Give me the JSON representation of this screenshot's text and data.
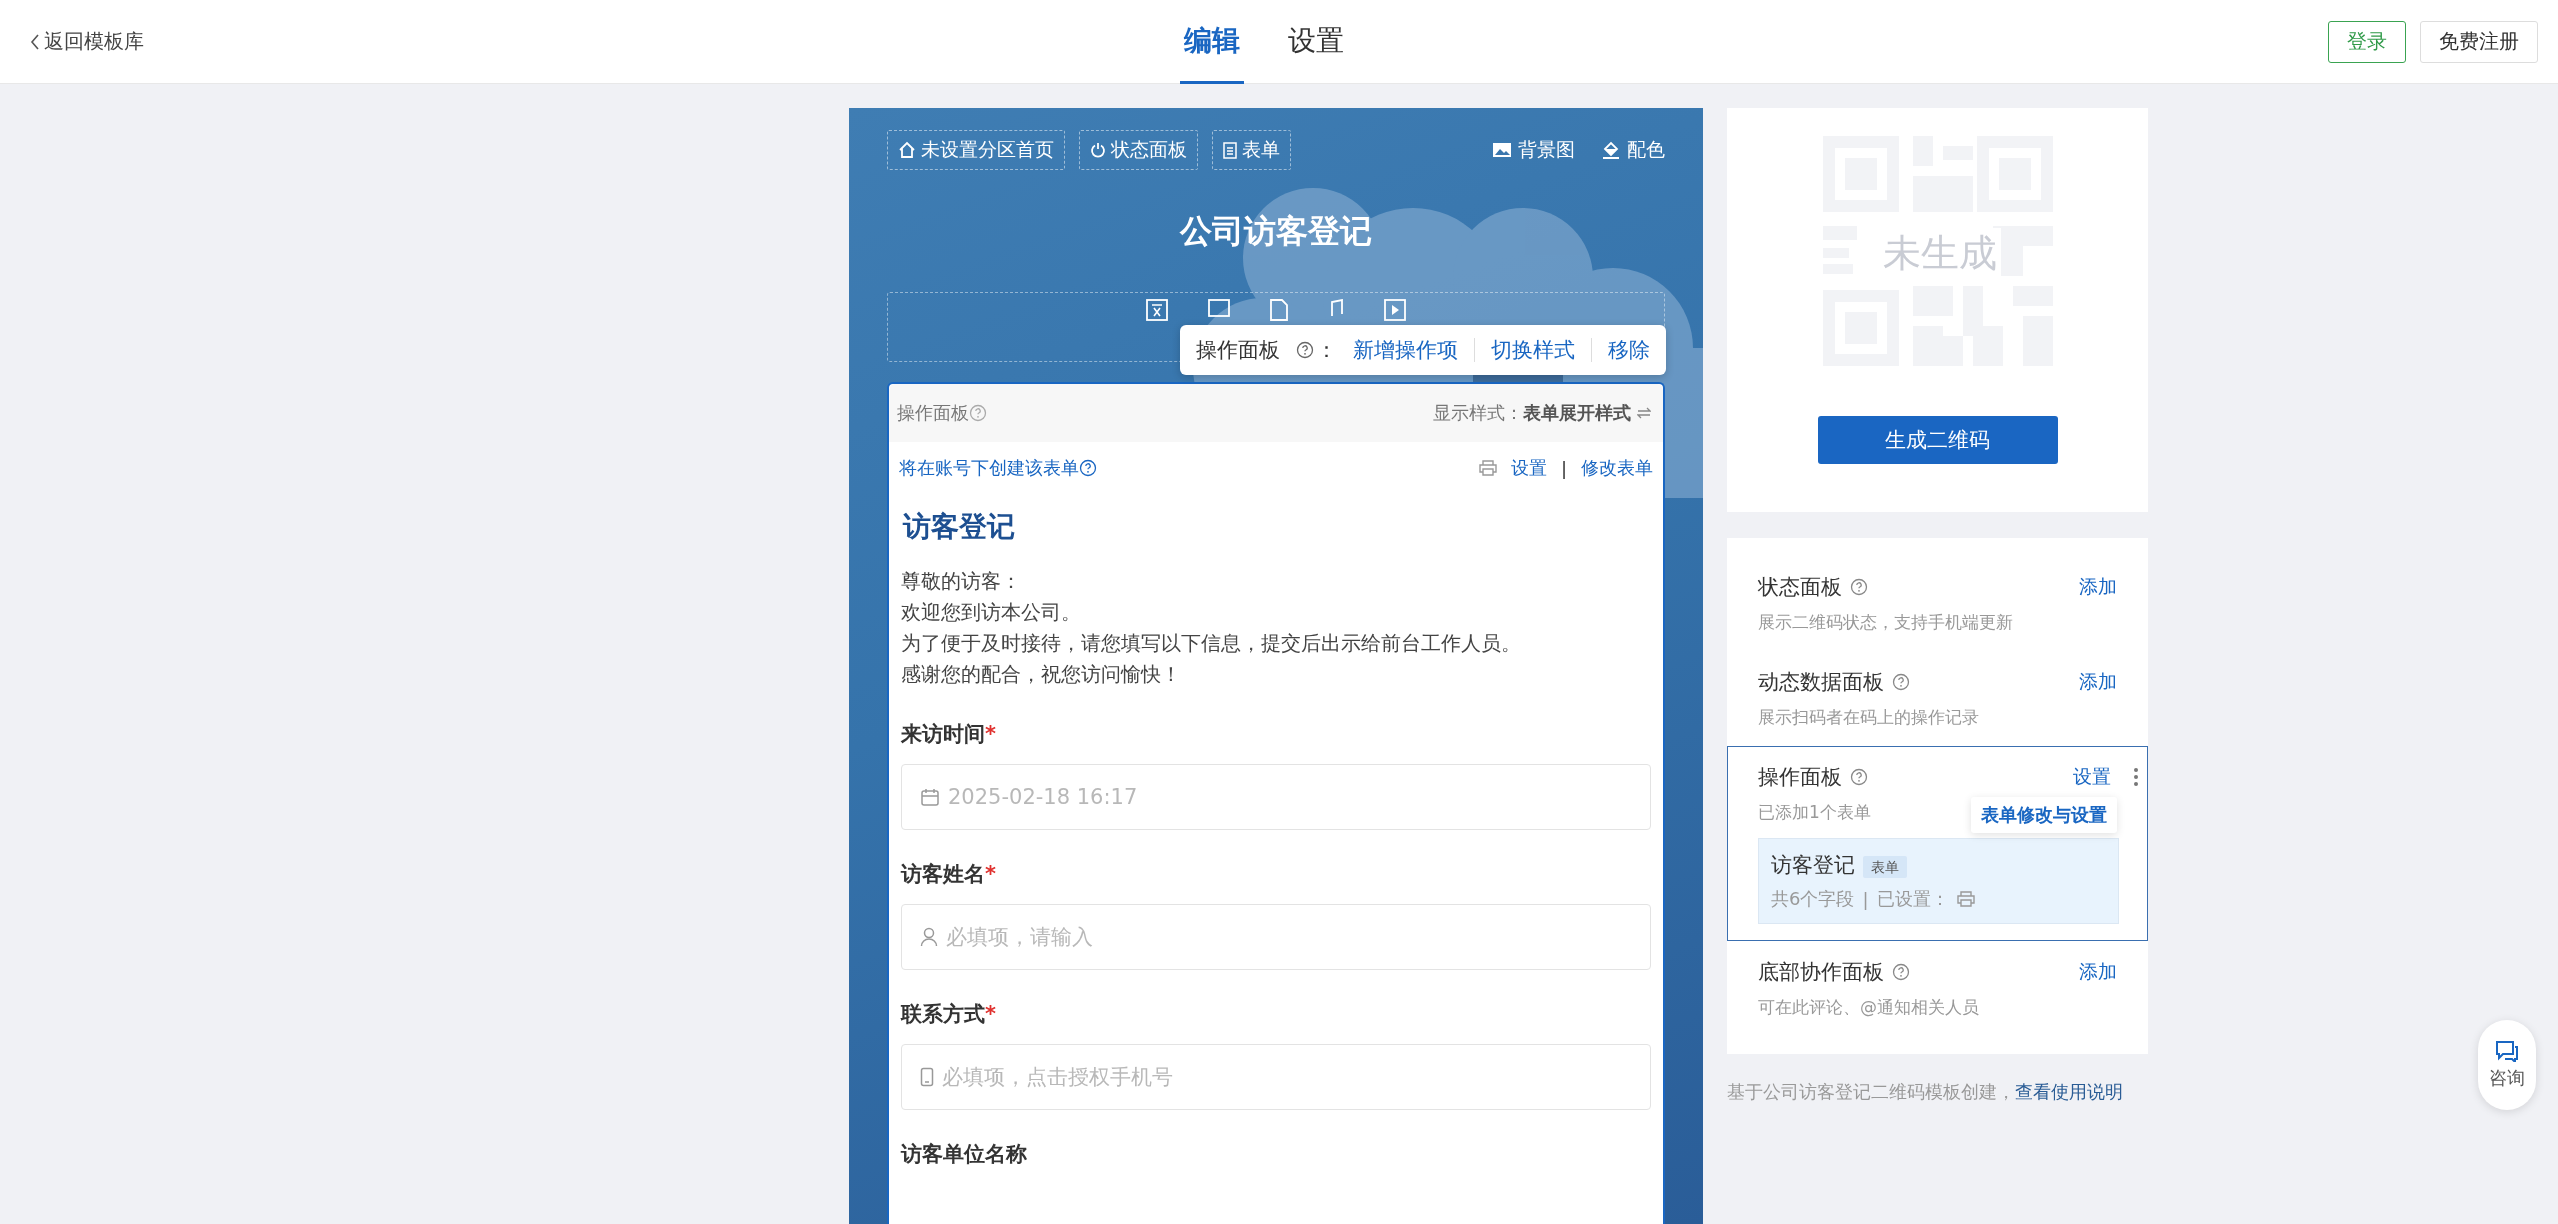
{
  "topbar": {
    "back": "返回模板库",
    "tabs": [
      {
        "label": "编辑",
        "selected": true
      },
      {
        "label": "设置",
        "selected": false
      }
    ],
    "login": "登录",
    "register": "免费注册"
  },
  "preview": {
    "nav_chips": [
      {
        "label": "未设置分区首页",
        "kind": "home"
      },
      {
        "label": "状态面板",
        "kind": "power"
      },
      {
        "label": "表单",
        "kind": "form"
      }
    ],
    "right_actions": [
      {
        "label": "背景图",
        "kind": "image"
      },
      {
        "label": "配色",
        "kind": "paint"
      }
    ],
    "title": "公司访客登记",
    "action_bar": {
      "label": "操作面板",
      "colon": "：",
      "actions": [
        "新增操作项",
        "切换样式",
        "移除"
      ]
    },
    "panel": {
      "label": "操作面板",
      "style_label": "显示样式：",
      "style_value": "表单展开样式",
      "create_link": "将在账号下创建该表单",
      "links": [
        "设置",
        "修改表单"
      ],
      "separator": "|"
    },
    "form": {
      "title": "访客登记",
      "required_mark": "*",
      "intro": [
        "尊敬的访客：",
        "欢迎您到访本公司。",
        "为了便于及时接待，请您填写以下信息，提交后出示给前台工作人员。",
        "感谢您的配合，祝您访问愉快！"
      ],
      "fields": [
        {
          "label": "来访时间",
          "required": true,
          "kind": "date",
          "placeholder": "2025-02-18 16:17"
        },
        {
          "label": "访客姓名",
          "required": true,
          "kind": "person",
          "placeholder": "必填项，请输入"
        },
        {
          "label": "联系方式",
          "required": true,
          "kind": "phone",
          "placeholder": "必填项，点击授权手机号"
        },
        {
          "label": "访客单位名称",
          "required": false,
          "kind": "label"
        }
      ]
    }
  },
  "qr": {
    "overlay": "未生成",
    "button": "生成二维码"
  },
  "panels": [
    {
      "title": "状态面板",
      "description": "展示二维码状态，支持手机端更新",
      "action": "添加",
      "selected": false
    },
    {
      "title": "动态数据面板",
      "description": "展示扫码者在码上的操作记录",
      "action": "添加",
      "selected": false
    },
    {
      "title": "操作面板",
      "description": "已添加1个表单",
      "action": "设置",
      "selected": true,
      "tooltip": "表单修改与设置",
      "forms": [
        {
          "name": "访客登记",
          "tag": "表单",
          "count": "共6个字段",
          "separator": "|",
          "configured": "已设置："
        }
      ]
    },
    {
      "title": "底部协作面板",
      "description": "可在此评论、@通知相关人员",
      "action": "添加",
      "selected": false
    }
  ],
  "footer": {
    "text": "基于公司访客登记二维码模板创建，",
    "link": "查看使用说明"
  },
  "consult": {
    "label": "咨询"
  }
}
